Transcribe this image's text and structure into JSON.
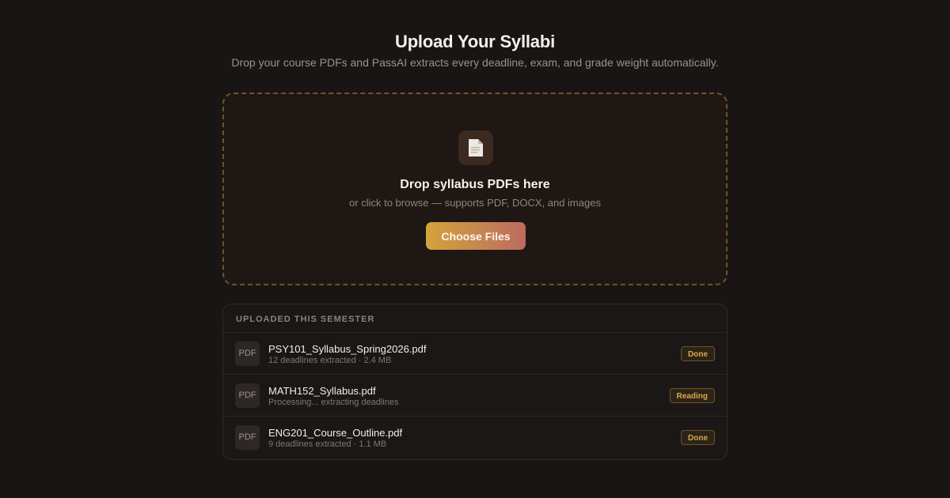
{
  "header": {
    "title": "Upload Your Syllabi",
    "subtitle": "Drop your course PDFs and PassAI extracts every deadline, exam, and grade weight automatically."
  },
  "dropzone": {
    "icon": "file-icon",
    "title": "Drop syllabus PDFs here",
    "subtitle": "or click to browse — supports PDF, DOCX, and images",
    "button_label": "Choose Files"
  },
  "uploaded": {
    "heading": "UPLOADED THIS SEMESTER",
    "files": [
      {
        "type_label": "PDF",
        "name": "PSY101_Syllabus_Spring2026.pdf",
        "meta": "12 deadlines extracted · 2.4 MB",
        "status": "Done"
      },
      {
        "type_label": "PDF",
        "name": "MATH152_Syllabus.pdf",
        "meta": "Processing... extracting deadlines",
        "status": "Reading"
      },
      {
        "type_label": "PDF",
        "name": "ENG201_Course_Outline.pdf",
        "meta": "9 deadlines extracted · 1.1 MB",
        "status": "Done"
      }
    ]
  },
  "colors": {
    "background": "#1a1515",
    "accent_gradient_start": "#d3a33a",
    "accent_gradient_end": "#bd6a5f",
    "status_text": "#d7a94a"
  }
}
